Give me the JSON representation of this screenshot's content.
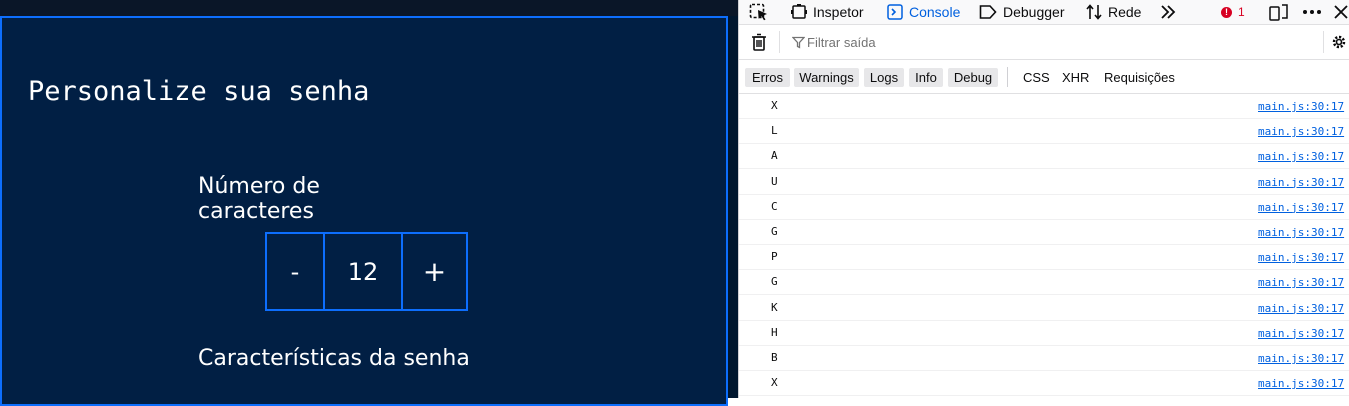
{
  "app": {
    "title": "Personalize sua senha",
    "count_label": "Número de caracteres",
    "minus_label": "-",
    "count_value": "12",
    "plus_label": "+",
    "features_label": "Características da senha"
  },
  "devtools": {
    "tabs": [
      {
        "label": "Inspetor",
        "icon": "inspector-icon"
      },
      {
        "label": "Console",
        "icon": "console-icon",
        "active": true
      },
      {
        "label": "Debugger",
        "icon": "debugger-icon"
      },
      {
        "label": "Rede",
        "icon": "network-icon"
      }
    ],
    "error_count": "1",
    "error_icon_glyph": "!",
    "filter_placeholder": "Filtrar saída",
    "levels": [
      "Erros",
      "Warnings",
      "Logs",
      "Info",
      "Debug"
    ],
    "net_filters": [
      "CSS",
      "XHR",
      "Requisições"
    ],
    "logs": [
      {
        "msg": "X",
        "src": "main.js:30:17"
      },
      {
        "msg": "L",
        "src": "main.js:30:17"
      },
      {
        "msg": "A",
        "src": "main.js:30:17"
      },
      {
        "msg": "U",
        "src": "main.js:30:17"
      },
      {
        "msg": "C",
        "src": "main.js:30:17"
      },
      {
        "msg": "G",
        "src": "main.js:30:17"
      },
      {
        "msg": "P",
        "src": "main.js:30:17"
      },
      {
        "msg": "G",
        "src": "main.js:30:17"
      },
      {
        "msg": "K",
        "src": "main.js:30:17"
      },
      {
        "msg": "H",
        "src": "main.js:30:17"
      },
      {
        "msg": "B",
        "src": "main.js:30:17"
      },
      {
        "msg": "X",
        "src": "main.js:30:17"
      }
    ]
  },
  "colors": {
    "app_bg": "#011f44",
    "accent_blue": "#0d6efd",
    "devtools_active": "#0060df",
    "error_red": "#d70022"
  }
}
